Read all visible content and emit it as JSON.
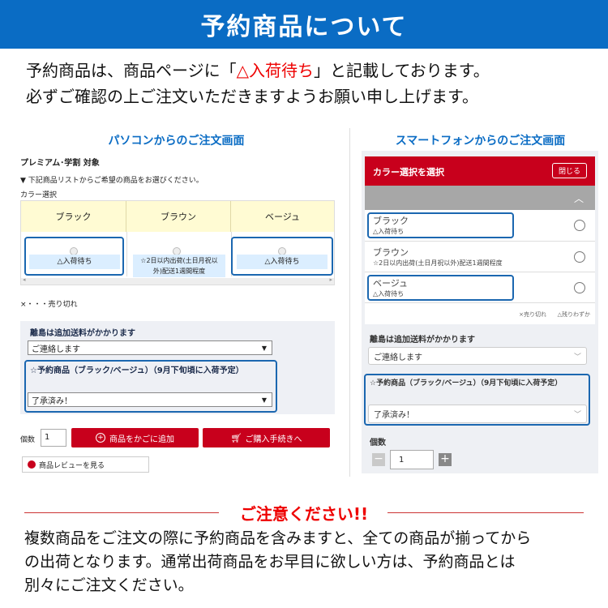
{
  "header": {
    "title": "予約商品について"
  },
  "intro": {
    "line1_a": "予約商品は、商品ページに「",
    "line1_red": "△入荷待ち",
    "line1_b": "」と記載しております。",
    "line2": "必ずご確認の上ご注文いただきますようお願い申し上げます。"
  },
  "pc": {
    "section_title": "パソコンからのご注文画面",
    "campaign": "プレミアム･学割 対象",
    "instruction": "▼ 下記商品リストからご希望の商品をお選びください。",
    "color_label": "カラー選択",
    "colors": [
      {
        "name": "ブラック",
        "status": "△入荷待ち"
      },
      {
        "name": "ブラウン",
        "status": "☆2日以内出荷(土日月祝以外)配送1週間程度"
      },
      {
        "name": "ベージュ",
        "status": "△入荷待ち"
      }
    ],
    "legend": "×・・・売り切れ",
    "shipping_title": "離島は追加送料がかかります",
    "shipping_select": "ご連絡します",
    "reserve_title": "☆予約商品（ブラック/ベージュ）（9月下旬頃に入荷予定）",
    "reserve_select": "了承済み！",
    "qty_label": "個数",
    "qty_value": "1",
    "cart_button": "商品をかごに追加",
    "checkout_button": "ご購入手続きへ",
    "review_button": "商品レビューを見る"
  },
  "sp": {
    "section_title": "スマートフォンからのご注文画面",
    "header_title": "カラー選択を選択",
    "close_button": "閉じる",
    "colors": [
      {
        "name": "ブラック",
        "status": "△入荷待ち"
      },
      {
        "name": "ブラウン",
        "status": "☆2日以内出荷(土日月祝以外)配送1週間程度"
      },
      {
        "name": "ベージュ",
        "status": "△入荷待ち"
      }
    ],
    "legend_sold": "×売り切れ",
    "legend_few": "△残りわずか",
    "shipping_title": "離島は追加送料がかかります",
    "shipping_select": "ご連絡します",
    "reserve_title": "☆予約商品（ブラック/ベージュ）（9月下旬頃に入荷予定）",
    "reserve_select": "了承済み！",
    "qty_label": "個数",
    "qty_value": "1"
  },
  "notice": {
    "title": "ご注意ください!!",
    "line1": "複数商品をご注文の際に予約商品を含みますと、全ての商品が揃ってから",
    "line2": "の出荷となります。通常出荷商品をお早目に欲しい方は、予約商品とは",
    "line3": "別々にご注文ください。"
  }
}
